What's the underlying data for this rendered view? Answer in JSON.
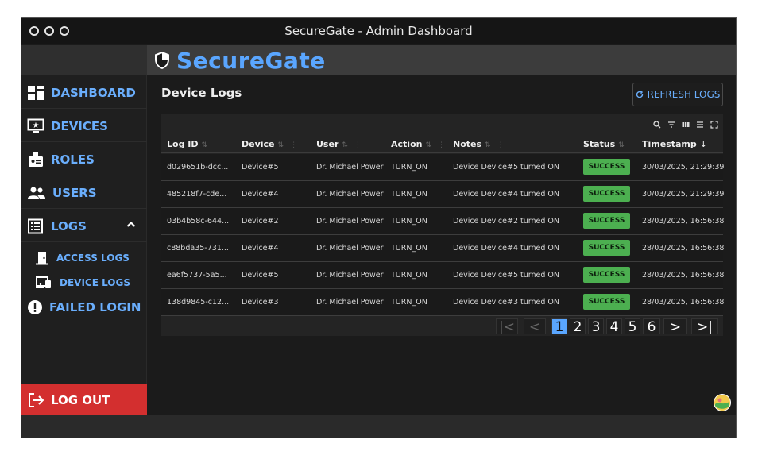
{
  "window": {
    "title": "SecureGate - Admin Dashboard"
  },
  "brand": {
    "name": "SecureGate"
  },
  "sidebar": {
    "items": [
      {
        "label": "DASHBOARD",
        "icon": "dashboard-icon"
      },
      {
        "label": "DEVICES",
        "icon": "devices-icon"
      },
      {
        "label": "ROLES",
        "icon": "roles-icon"
      },
      {
        "label": "USERS",
        "icon": "users-icon"
      },
      {
        "label": "LOGS",
        "icon": "logs-icon"
      },
      {
        "label": "ACCESS LOGS",
        "icon": "door-icon"
      },
      {
        "label": "DEVICE LOGS",
        "icon": "device-logs-icon"
      },
      {
        "label": "FAILED LOGIN",
        "icon": "alert-icon"
      }
    ],
    "logout_label": "LOG OUT"
  },
  "main": {
    "title": "Device Logs",
    "refresh_label": "REFRESH LOGS"
  },
  "table": {
    "columns": [
      "Log ID",
      "Device",
      "User",
      "Action",
      "Notes",
      "Status",
      "Timestamp"
    ],
    "rows": [
      [
        "d029651b-dcc...",
        "Device#5",
        "Dr. Michael Power",
        "TURN_ON",
        "Device Device#5 turned ON",
        "SUCCESS",
        "30/03/2025, 21:29:39"
      ],
      [
        "485218f7-cde...",
        "Device#4",
        "Dr. Michael Power",
        "TURN_ON",
        "Device Device#4 turned ON",
        "SUCCESS",
        "30/03/2025, 21:29:39"
      ],
      [
        "03b4b58c-644...",
        "Device#2",
        "Dr. Michael Power",
        "TURN_ON",
        "Device Device#2 turned ON",
        "SUCCESS",
        "28/03/2025, 16:56:38"
      ],
      [
        "c88bda35-731...",
        "Device#4",
        "Dr. Michael Power",
        "TURN_ON",
        "Device Device#4 turned ON",
        "SUCCESS",
        "28/03/2025, 16:56:38"
      ],
      [
        "ea6f5737-5a5...",
        "Device#5",
        "Dr. Michael Power",
        "TURN_ON",
        "Device Device#5 turned ON",
        "SUCCESS",
        "28/03/2025, 16:56:38"
      ],
      [
        "138d9845-c12...",
        "Device#3",
        "Dr. Michael Power",
        "TURN_ON",
        "Device Device#3 turned ON",
        "SUCCESS",
        "28/03/2025, 16:56:38"
      ]
    ],
    "status_color": "#4caf50"
  },
  "pagination": {
    "pages": [
      "1",
      "2",
      "3",
      "4",
      "5",
      "6"
    ],
    "current": "1",
    "first": "|<",
    "prev": "<",
    "next": ">",
    "last": ">|"
  },
  "colors": {
    "accent": "#5aa6ff",
    "danger": "#d32f2f",
    "success": "#4caf50"
  }
}
